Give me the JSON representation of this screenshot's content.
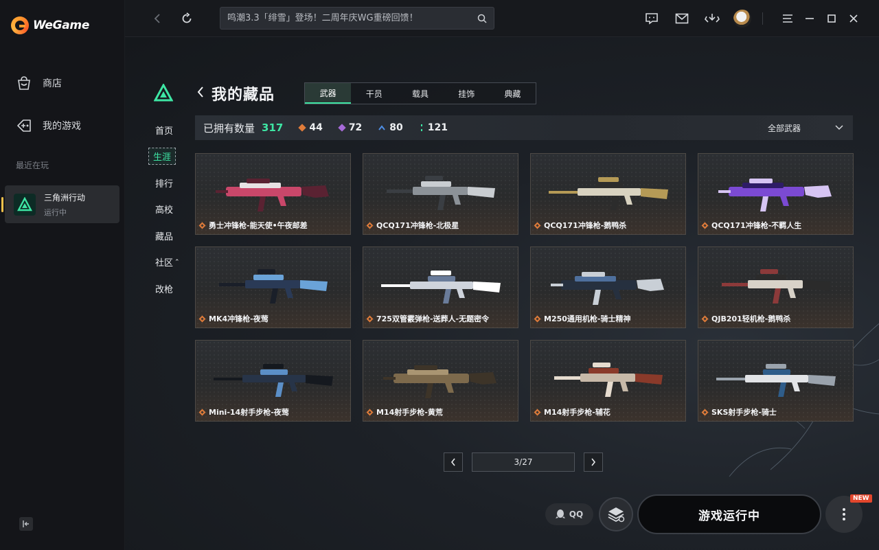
{
  "app": {
    "brand": "WeGame"
  },
  "sidebar": {
    "items": [
      {
        "label": "商店",
        "icon": "shop-bag-icon"
      },
      {
        "label": "我的游戏",
        "icon": "gamepad-icon"
      }
    ],
    "recent_label": "最近在玩",
    "recent_game": {
      "name": "三角洲行动",
      "status": "运行中"
    }
  },
  "topbar": {
    "search_placeholder": "鸣潮3.3「绯雪」登场！二周年庆WG重磅回馈！"
  },
  "game_nav": {
    "items": [
      "首页",
      "生涯",
      "排行",
      "高校",
      "藏品",
      "社区",
      "改枪"
    ],
    "active": "生涯",
    "community_suffix": "⌃"
  },
  "page": {
    "title": "我的藏品",
    "tabs": [
      "武器",
      "干员",
      "载具",
      "挂饰",
      "典藏"
    ],
    "active_tab": "武器",
    "owned_label": "已拥有数量",
    "owned_count": "317",
    "stats": [
      {
        "value": "44",
        "color": "#e07c3a"
      },
      {
        "value": "72",
        "color": "#a66ad8"
      },
      {
        "value": "80",
        "color": "#4f8fe6"
      },
      {
        "value": "121",
        "color": "#3ee6a4"
      }
    ],
    "filter_label": "全部武器"
  },
  "items": [
    {
      "name": "勇士冲锋枪-能天使•午夜邮差",
      "palette": [
        "#c9476a",
        "#e7e2e4",
        "#5a2232"
      ]
    },
    {
      "name": "QCQ171冲锋枪-北极星",
      "palette": [
        "#8c9298",
        "#c9cdd1",
        "#3a3e43"
      ]
    },
    {
      "name": "QCQ171冲锋枪-鹅鸭杀",
      "palette": [
        "#d8d2c0",
        "#2c2c2c",
        "#b59a56"
      ]
    },
    {
      "name": "QCQ171冲锋枪-不羁人生",
      "palette": [
        "#7b4ad3",
        "#2e1c66",
        "#d6c4f3"
      ]
    },
    {
      "name": "MK4冲锋枪-夜莺",
      "palette": [
        "#2a3a56",
        "#6aa3d8",
        "#1a1f29"
      ]
    },
    {
      "name": "725双管霰弹枪-送葬人-无题密令",
      "palette": [
        "#cfd4dc",
        "#6a7c9a",
        "#ffffff"
      ]
    },
    {
      "name": "M250通用机枪-骑士精神",
      "palette": [
        "#26303f",
        "#4e6f9c",
        "#c9cfd6"
      ]
    },
    {
      "name": "QJB201轻机枪-鹅鸭杀",
      "palette": [
        "#d8d2c8",
        "#2b2b2b",
        "#8c3a3a"
      ]
    },
    {
      "name": "Mini-14射手步枪-夜莺",
      "palette": [
        "#273448",
        "#5b8fc7",
        "#15191f"
      ]
    },
    {
      "name": "M14射手步枪-黄荒",
      "palette": [
        "#7d6a4c",
        "#a99572",
        "#3d3428"
      ]
    },
    {
      "name": "M14射手步枪-辅花",
      "palette": [
        "#c7b9a8",
        "#8a3a2a",
        "#e6dccf"
      ]
    },
    {
      "name": "SKS射手步枪-骑士",
      "palette": [
        "#e2e4e7",
        "#2f5d8a",
        "#9aa3ad"
      ]
    }
  ],
  "pager": {
    "text": "3/27"
  },
  "bottom": {
    "qq_label": "QQ",
    "play_label": "游戏运行中",
    "new_badge": "NEW"
  }
}
